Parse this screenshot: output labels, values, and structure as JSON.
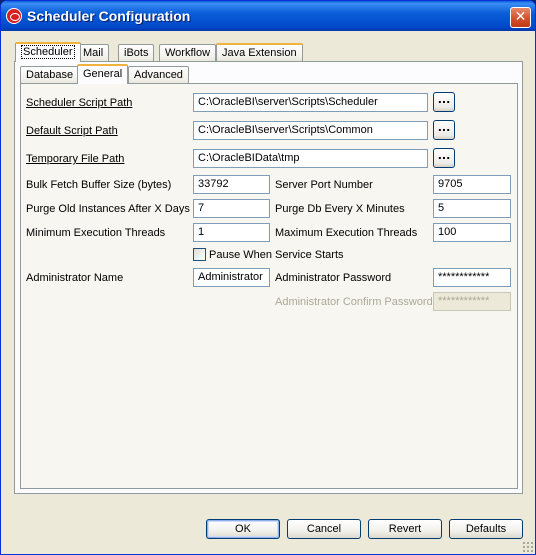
{
  "window": {
    "title": "Scheduler Configuration",
    "close_glyph": "✕"
  },
  "top_tabs": [
    "Scheduler",
    "Mail",
    "iBots",
    "Workflow",
    "Java Extension"
  ],
  "sub_tabs": [
    "Database",
    "General",
    "Advanced"
  ],
  "form": {
    "scheduler_script_path": {
      "label": "Scheduler Script Path",
      "value": "C:\\OracleBI\\server\\Scripts\\Scheduler"
    },
    "default_script_path": {
      "label": "Default Script Path",
      "value": "C:\\OracleBI\\server\\Scripts\\Common"
    },
    "temporary_file_path": {
      "label": "Temporary File Path",
      "value": "C:\\OracleBIData\\tmp"
    },
    "browse_label": "...",
    "bulk_fetch": {
      "label": "Bulk Fetch Buffer Size (bytes)",
      "value": "33792"
    },
    "server_port": {
      "label": "Server Port Number",
      "value": "9705"
    },
    "purge_instances": {
      "label": "Purge Old Instances After X Days",
      "value": "7"
    },
    "purge_db": {
      "label": "Purge Db Every X Minutes",
      "value": "5"
    },
    "min_threads": {
      "label": "Minimum Execution Threads",
      "value": "1"
    },
    "max_threads": {
      "label": "Maximum Execution Threads",
      "value": "100"
    },
    "pause_checkbox": {
      "label": "Pause When Service Starts",
      "checked": false
    },
    "admin_name": {
      "label": "Administrator Name",
      "value": "Administrator"
    },
    "admin_password": {
      "label": "Administrator Password",
      "value": "************"
    },
    "admin_confirm": {
      "label": "Administrator Confirm Password",
      "value": "************"
    }
  },
  "buttons": {
    "ok": "OK",
    "cancel": "Cancel",
    "revert": "Revert",
    "defaults": "Defaults"
  },
  "colors": {
    "titlebar": "#0a5fd8",
    "dialog_bg": "#ece9d8",
    "tab_highlight": "#f0b33b",
    "close": "#d4502a"
  }
}
